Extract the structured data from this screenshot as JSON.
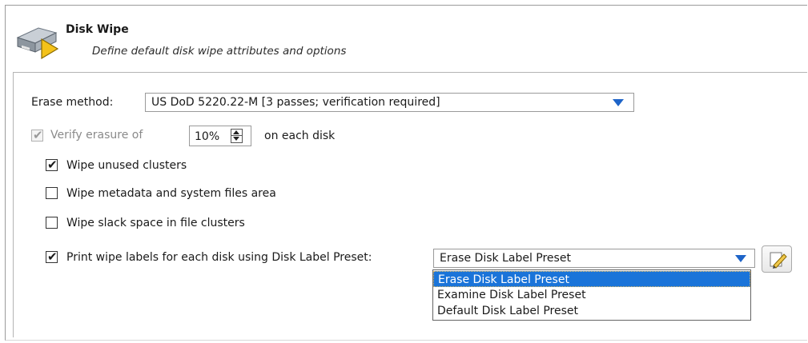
{
  "header": {
    "title": "Disk Wipe",
    "subtitle": "Define default disk wipe attributes and options"
  },
  "erase_method": {
    "label": "Erase method:",
    "value": "US DoD 5220.22-M [3 passes; verification required]"
  },
  "verify": {
    "label": "Verify erasure of",
    "checked": true,
    "disabled": true,
    "value": "10%",
    "suffix": "on each disk"
  },
  "options": [
    {
      "label": "Wipe unused clusters",
      "checked": true
    },
    {
      "label": "Wipe metadata and system files area",
      "checked": false
    },
    {
      "label": "Wipe slack space in file clusters",
      "checked": false
    }
  ],
  "print_labels": {
    "label": "Print wipe labels for each disk using Disk Label Preset:",
    "checked": true,
    "preset_value": "Erase Disk Label Preset",
    "dropdown_options": [
      {
        "label": "Erase Disk Label Preset",
        "selected": true
      },
      {
        "label": "Examine Disk Label Preset",
        "selected": false
      },
      {
        "label": "Default Disk Label Preset",
        "selected": false
      }
    ]
  },
  "colors": {
    "accent": "#1a74d9",
    "arrow": "#1e64c8"
  },
  "icons": {
    "header": "disk-wipe-icon",
    "edit": "edit-pencil-icon"
  }
}
